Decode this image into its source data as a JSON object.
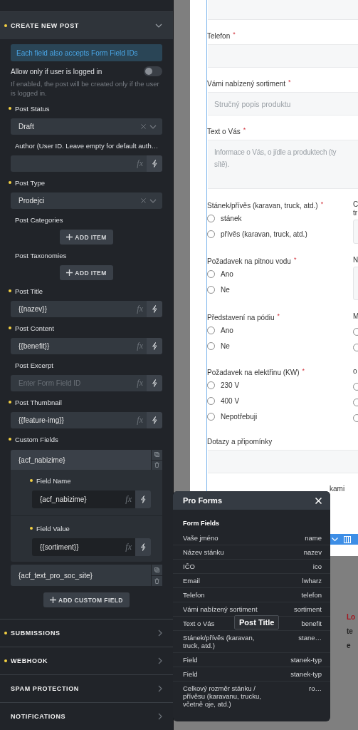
{
  "sidebar": {
    "section": {
      "title": "CREATE NEW POST",
      "modified": true,
      "expanded": true
    },
    "notice": "Each field also accepts Form Field IDs",
    "login_toggle": {
      "label": "Allow only if user is logged in",
      "on": false,
      "help": "If enabled, the post will be created only if the user is logged in."
    },
    "controls": [
      {
        "kind": "select",
        "label": "Post Status",
        "modified": true,
        "value": "Draft"
      },
      {
        "kind": "input",
        "label": "Author (User ID. Leave empty for default auth…",
        "modified": false,
        "fx": "fx"
      },
      {
        "kind": "select",
        "label": "Post Type",
        "modified": true,
        "value": "Prodejci"
      },
      {
        "kind": "add",
        "label": "Post Categories",
        "modified": false,
        "button": "ADD ITEM"
      },
      {
        "kind": "add",
        "label": "Post Taxonomies",
        "modified": false,
        "button": "ADD ITEM"
      },
      {
        "kind": "input",
        "label": "Post Title",
        "modified": true,
        "value": "{{nazev}}",
        "fx": "fx"
      },
      {
        "kind": "input",
        "label": "Post Content",
        "modified": true,
        "value": "{{benefit}}",
        "fx": "fx"
      },
      {
        "kind": "input",
        "label": "Post Excerpt",
        "modified": false,
        "placeholder": "Enter Form Field ID",
        "fx": "fx"
      },
      {
        "kind": "input",
        "label": "Post Thumbnail",
        "modified": true,
        "value": "{{feature-img}}",
        "fx": "fx"
      },
      {
        "kind": "repeater",
        "label": "Custom Fields",
        "modified": true,
        "items": [
          {
            "title": "{acf_nabizime}",
            "expanded": true,
            "fields": [
              {
                "label": "Field Name",
                "modified": true,
                "value": "{acf_nabizime}",
                "fx": "fx"
              },
              {
                "label": "Field Value",
                "modified": true,
                "value": "{{sortiment}}",
                "fx": "fx"
              }
            ]
          },
          {
            "title": "{acf_text_pro_soc_site}",
            "expanded": false
          }
        ],
        "button": "ADD CUSTOM FIELD"
      }
    ],
    "sections": [
      {
        "title": "SUBMISSIONS",
        "modified": true,
        "expanded": false
      },
      {
        "title": "WEBHOOK",
        "modified": true,
        "expanded": false
      },
      {
        "title": "SPAM PROTECTION",
        "modified": false,
        "expanded": false
      },
      {
        "title": "NOTIFICATIONS",
        "modified": false,
        "expanded": false
      }
    ]
  },
  "canvas": {
    "fields": [
      {
        "kind": "text",
        "label": "Telefon",
        "mark": "*"
      },
      {
        "kind": "text",
        "label": "Vámi nabízený sortiment",
        "mark": "*",
        "placeholder": "Stručný popis produktu"
      },
      {
        "kind": "textarea",
        "label": "Text o Vás",
        "mark": "*",
        "placeholder_lines": [
          "Informace o Vás, o jídle a produktech (ty",
          "sítě)."
        ]
      }
    ],
    "groups": [
      {
        "left": {
          "label": "Stánek/přívěs (karavan, truck, atd.)",
          "mark": "*",
          "options": [
            {
              "label": "stánek",
              "selected": false
            },
            {
              "label": "přívěs (karavan, truck, atd.)",
              "selected": false
            }
          ]
        },
        "right": {
          "kind": "box",
          "label_lines": [
            "C",
            "tr"
          ]
        }
      },
      {
        "left": {
          "label": "Požadavek na pitnou vodu",
          "mark": "*",
          "options": [
            {
              "label": "Ano",
              "selected": false
            },
            {
              "label": "Ne",
              "selected": false
            }
          ]
        },
        "right": {
          "kind": "box",
          "label_lines": [
            "N"
          ]
        }
      },
      {
        "left": {
          "label": "Představení na pódiu",
          "mark": "*",
          "options": [
            {
              "label": "Ano",
              "selected": false
            },
            {
              "label": "Ne",
              "selected": false
            }
          ]
        },
        "right": {
          "kind": "radios",
          "label_lines": [
            "M"
          ],
          "options": [
            {
              "selected": false
            },
            {
              "selected": false
            }
          ]
        }
      },
      {
        "left": {
          "label": "Požadavek na elektřinu (KW)",
          "mark": "*",
          "options": [
            {
              "label": "230 V",
              "selected": false
            },
            {
              "label": "400 V",
              "selected": false
            },
            {
              "label": "Nepotřebuji",
              "selected": false
            }
          ]
        },
        "right": {
          "kind": "radios",
          "label_lines": [
            "o"
          ],
          "options": [
            {
              "selected": false
            },
            {
              "selected": false
            },
            {
              "selected": false
            }
          ]
        }
      }
    ],
    "comments": {
      "label": "Dotazy a připomínky"
    },
    "fragment": "kami"
  },
  "below": [
    {
      "kind": "link",
      "text": "Lo"
    },
    {
      "kind": "bold",
      "text": "te"
    },
    {
      "kind": "bold",
      "text": "e"
    }
  ],
  "popup": {
    "title": "Pro Forms",
    "heading": "Form Fields",
    "rows": [
      {
        "label": "Vaše jméno",
        "id": "name"
      },
      {
        "label": "Název stánku",
        "id": "nazev"
      },
      {
        "label": "IČO",
        "id": "ico"
      },
      {
        "label": "Email",
        "id": "lwharz"
      },
      {
        "label": "Telefon",
        "id": "telefon"
      },
      {
        "label": "Vámi nabízený sortiment",
        "id": "sortiment"
      },
      {
        "label": "Text o Vás",
        "id": "benefit"
      },
      {
        "label": "Stánek/přívěs (karavan, truck, atd.)",
        "id": "stane…"
      },
      {
        "label": "Field",
        "id": "stanek-typ"
      },
      {
        "label": "Field",
        "id": "stanek-typ"
      },
      {
        "label": "Celkový rozměr stánku / přívěsu (karavanu, trucku, včetně oje, atd.)",
        "id": "ro…"
      }
    ]
  },
  "tooltip": "Post Title"
}
